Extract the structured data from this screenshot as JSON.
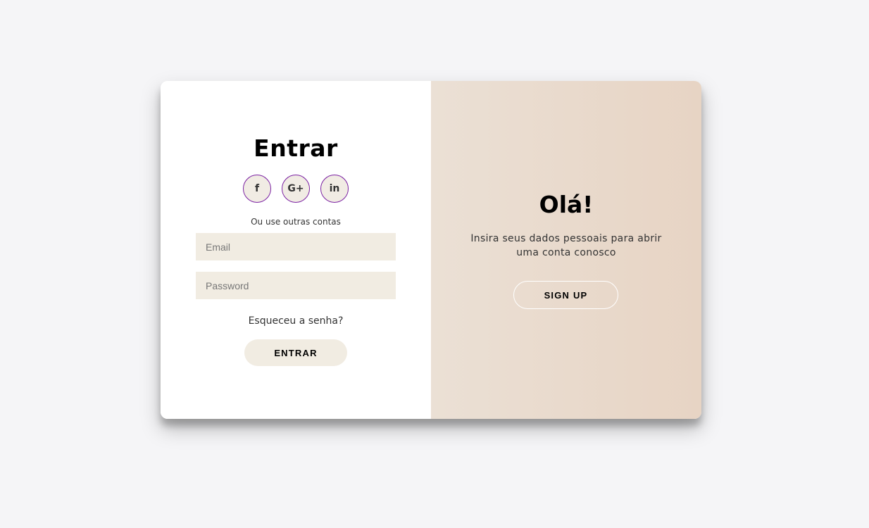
{
  "signin": {
    "title": "Entrar",
    "socials": [
      {
        "icon": "facebook-icon",
        "glyph": "f"
      },
      {
        "icon": "google-plus-icon",
        "glyph": "G+"
      },
      {
        "icon": "linkedin-icon",
        "glyph": "in"
      }
    ],
    "alt_text": "Ou use outras contas",
    "email_placeholder": "Email",
    "password_placeholder": "Password",
    "forgot_label": "Esqueceu a senha?",
    "submit_label": "ENTRAR"
  },
  "signup_panel": {
    "title": "Olá!",
    "text": "Insira seus dados pessoais para abrir uma conta conosco",
    "button_label": "SIGN UP"
  },
  "colors": {
    "page_bg": "#f5f5f7",
    "input_bg": "#f1ece2",
    "panel_gradient_start": "#ebe0d5",
    "panel_gradient_end": "#e7d4c4",
    "social_border": "#7a1fa2"
  }
}
